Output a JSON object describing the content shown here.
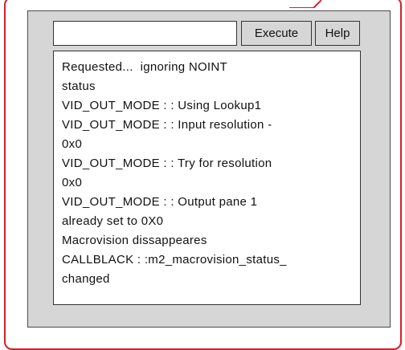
{
  "command_bar": {
    "input_value": "",
    "execute_label": "Execute",
    "help_label": "Help"
  },
  "output": {
    "lines": [
      "Requested...  ignoring NOINT",
      "status",
      "VID_OUT_MODE : : Using Lookup1",
      "VID_OUT_MODE : : Input resolution -",
      "0x0",
      "VID_OUT_MODE : : Try for resolution",
      "0x0",
      "VID_OUT_MODE : : Output pane 1",
      "already set to 0X0",
      "Macrovision dissappeares",
      "CALLBLACK : :m2_macrovision_status_",
      "changed"
    ]
  },
  "colors": {
    "frame_border": "#d6202a",
    "window_bg": "#d6d6d6"
  }
}
